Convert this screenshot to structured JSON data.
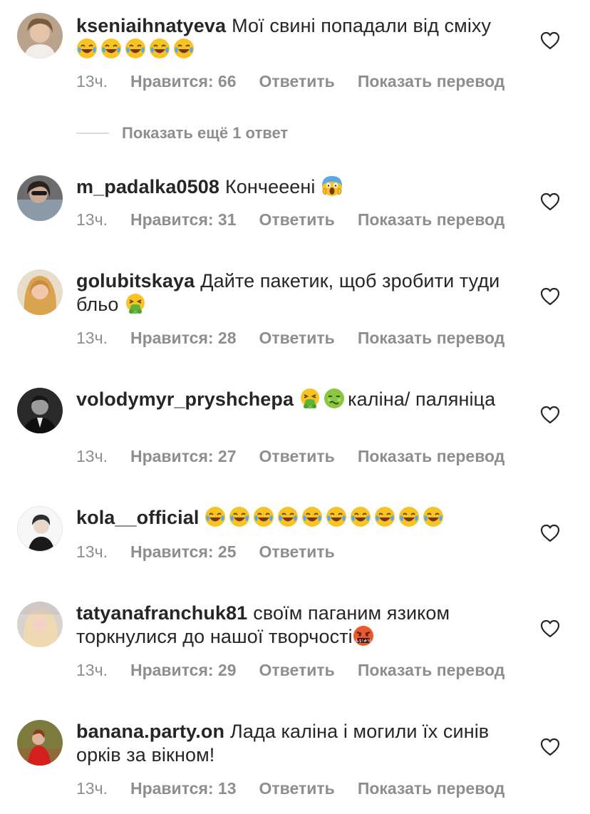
{
  "comments": [
    {
      "username": "kseniaihnatyeva",
      "text": "Мої свині попадали від сміху",
      "emojis": [
        "face-with-tears-of-joy",
        "face-with-tears-of-joy",
        "face-with-tears-of-joy",
        "face-with-tears-of-joy",
        "face-with-tears-of-joy"
      ],
      "time": "13ч.",
      "likes": "Нравится: 66",
      "reply": "Ответить",
      "translate": "Показать перевод"
    },
    {
      "username": "m_padalka0508",
      "text": "Кончееені",
      "emojis": [
        "face-screaming-in-fear"
      ],
      "time": "13ч.",
      "likes": "Нравится: 31",
      "reply": "Ответить",
      "translate": "Показать перевод"
    },
    {
      "username": "golubitskaya",
      "text": "Дайте пакетик,  щоб зробити туди бльо",
      "emojis": [
        "face-vomiting"
      ],
      "time": "13ч.",
      "likes": "Нравится: 28",
      "reply": "Ответить",
      "translate": "Показать перевод"
    },
    {
      "username": "volodymyr_pryshchepa",
      "text_before": "",
      "text": "каліна/ паляніца",
      "emojis": [
        "face-vomiting",
        "nauseated-face"
      ],
      "time": "13ч.",
      "likes": "Нравится: 27",
      "reply": "Ответить",
      "translate": "Показать перевод"
    },
    {
      "username": "kola__official",
      "text": "",
      "emojis": [
        "face-with-tears-of-joy",
        "face-with-tears-of-joy",
        "face-with-tears-of-joy",
        "face-with-tears-of-joy",
        "face-with-tears-of-joy",
        "face-with-tears-of-joy",
        "face-with-tears-of-joy",
        "face-with-tears-of-joy",
        "face-with-tears-of-joy",
        "face-with-tears-of-joy"
      ],
      "time": "13ч.",
      "likes": "Нравится: 25",
      "reply": "Ответить",
      "translate": ""
    },
    {
      "username": "tatyanafranchuk81",
      "text": "своїм паганим язиком торкнулися до нашої творчості",
      "emojis": [
        "face-with-symbols-on-mouth"
      ],
      "time": "13ч.",
      "likes": "Нравится: 29",
      "reply": "Ответить",
      "translate": "Показать перевод"
    },
    {
      "username": "banana.party.on",
      "text": "Лада каліна і могили їх синів орків за вікном!",
      "emojis": [],
      "time": "13ч.",
      "likes": "Нравится: 13",
      "reply": "Ответить",
      "translate": "Показать перевод"
    }
  ],
  "more_replies": "Показать ещё 1 ответ",
  "colors": {
    "text": "#262626",
    "meta": "#8e8e8e",
    "line": "#dbdbdb"
  },
  "icons": {
    "like": "heart-outline-icon"
  }
}
